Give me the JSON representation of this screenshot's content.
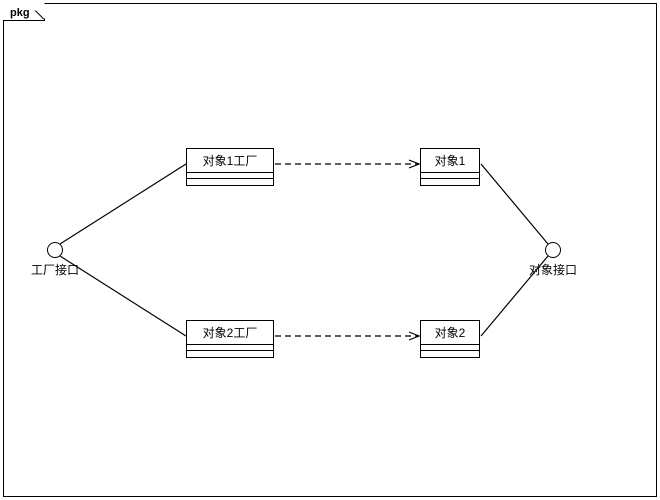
{
  "package": {
    "label": "pkg"
  },
  "interfaces": {
    "factory": {
      "label": "工厂接口"
    },
    "object": {
      "label": "对象接口"
    }
  },
  "classes": {
    "factory1": {
      "name": "对象1工厂"
    },
    "factory2": {
      "name": "对象2工厂"
    },
    "object1": {
      "name": "对象1"
    },
    "object2": {
      "name": "对象2"
    }
  }
}
